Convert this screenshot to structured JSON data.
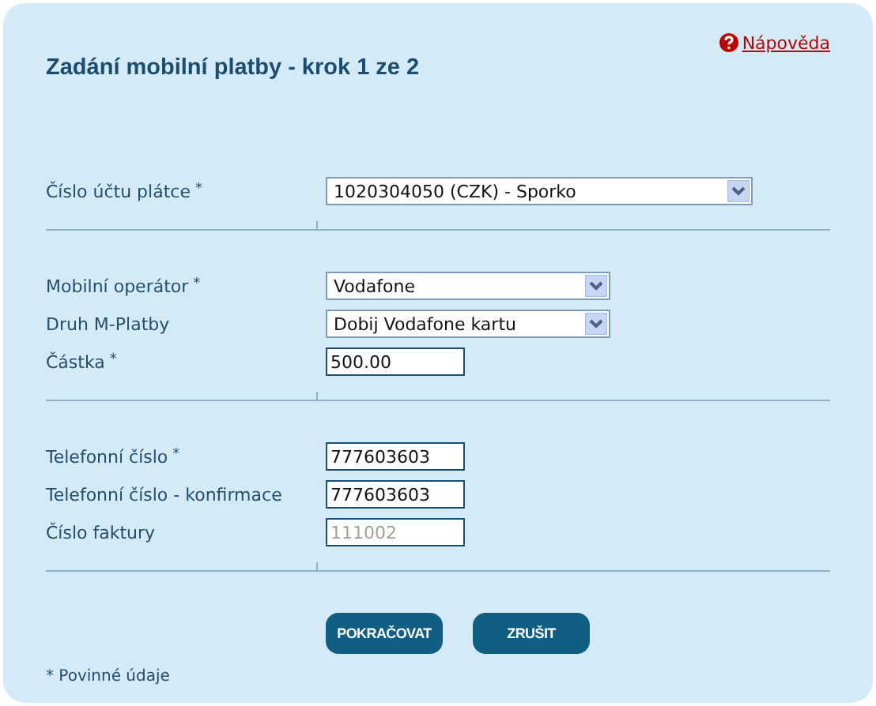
{
  "title": "Zadání mobilní platby - krok 1 ze 2",
  "help": {
    "label": "Nápověda"
  },
  "sections": [
    {
      "rows": [
        {
          "label": "Číslo účtu plátce",
          "required_mark": "*",
          "kind": "account-select",
          "value": "1020304050 (CZK) - Sporko"
        }
      ]
    },
    {
      "rows": [
        {
          "label": "Mobilní operátor",
          "required_mark": "*",
          "kind": "select",
          "value": "Vodafone"
        },
        {
          "label": "Druh M-Platby",
          "kind": "select",
          "value": "Dobij Vodafone kartu"
        },
        {
          "label": "Částka",
          "required_mark": "*",
          "kind": "input",
          "value": "500.00"
        }
      ]
    },
    {
      "rows": [
        {
          "label": "Telefonní číslo",
          "required_mark": "*",
          "kind": "input",
          "value": "777603603"
        },
        {
          "label": "Telefonní číslo - konfirmace",
          "kind": "input",
          "value": "777603603"
        },
        {
          "label": "Číslo faktury",
          "kind": "input",
          "value": "111002",
          "disabled": true
        }
      ]
    }
  ],
  "buttons": [
    "POKRAČOVAT",
    "ZRUŠIT"
  ],
  "footnote": "* Povinné údaje"
}
